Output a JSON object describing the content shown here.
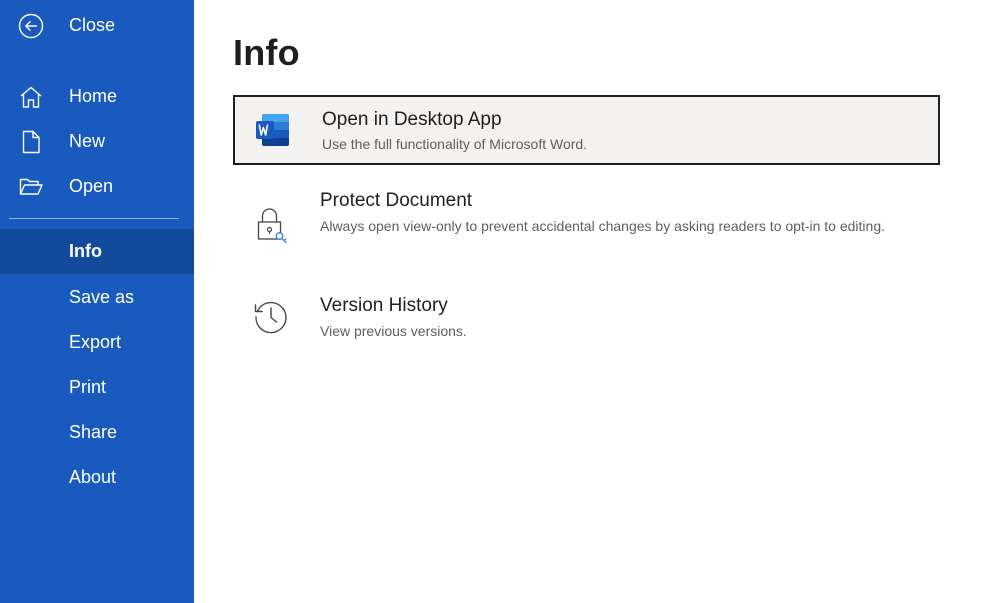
{
  "sidebar": {
    "close_label": "Close",
    "items": [
      {
        "label": "Home",
        "icon": "home-icon"
      },
      {
        "label": "New",
        "icon": "new-document-icon"
      },
      {
        "label": "Open",
        "icon": "folder-open-icon"
      },
      {
        "label": "Info"
      },
      {
        "label": "Save as"
      },
      {
        "label": "Export"
      },
      {
        "label": "Print"
      },
      {
        "label": "Share"
      },
      {
        "label": "About"
      }
    ],
    "active": "Info",
    "colors": {
      "background": "#185abd",
      "active": "#124a9c"
    }
  },
  "main": {
    "title": "Info",
    "cards": [
      {
        "title": "Open in Desktop App",
        "description": "Use the full functionality of Microsoft Word.",
        "icon": "word-app-icon",
        "selected": true
      },
      {
        "title": "Protect Document",
        "description": "Always open view-only to prevent accidental changes by asking readers to opt-in to editing.",
        "icon": "lock-key-icon"
      },
      {
        "title": "Version History",
        "description": "View previous versions.",
        "icon": "history-icon"
      }
    ]
  }
}
